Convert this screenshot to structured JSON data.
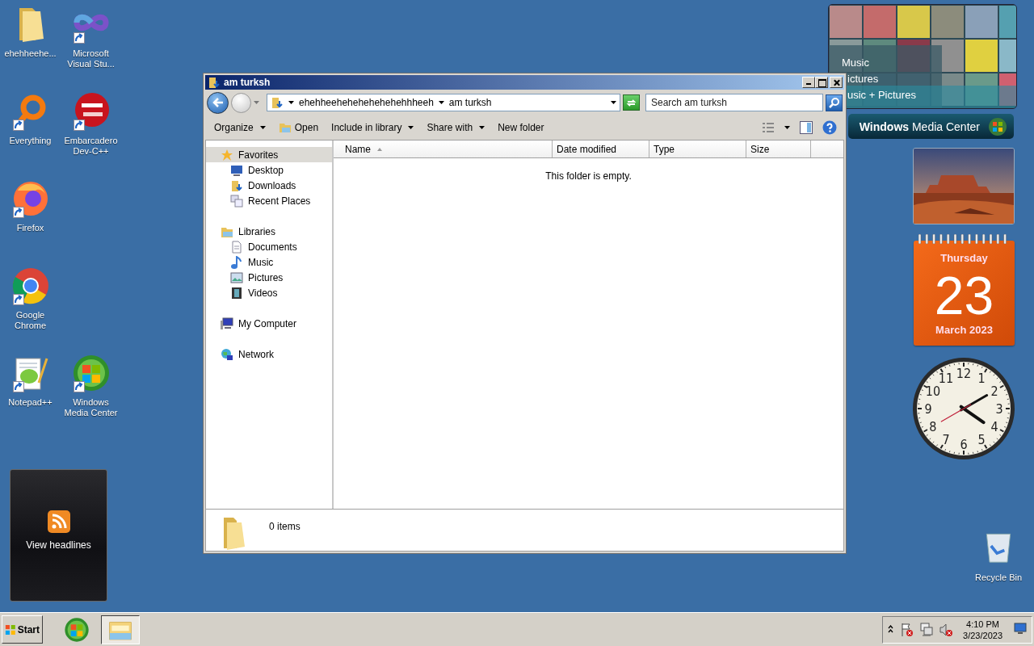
{
  "desktop_icon_rows": [
    [
      {
        "label": [
          "ehehheehe..."
        ],
        "kind": "folder",
        "shortcut": false
      },
      {
        "label": [
          "Microsoft",
          "Visual Stu..."
        ],
        "kind": "visual-studio",
        "shortcut": true
      }
    ],
    [
      {
        "label": [
          "Everything"
        ],
        "kind": "everything",
        "shortcut": true
      },
      {
        "label": [
          "Embarcadero",
          "Dev-C++"
        ],
        "kind": "devcpp",
        "shortcut": true
      }
    ],
    [
      {
        "label": [
          "Firefox"
        ],
        "kind": "firefox",
        "shortcut": true
      }
    ],
    [
      {
        "label": [
          "Google",
          "Chrome"
        ],
        "kind": "chrome",
        "shortcut": true
      }
    ],
    [
      {
        "label": [
          "Notepad++"
        ],
        "kind": "notepadpp",
        "shortcut": true
      },
      {
        "label": [
          "Windows",
          "Media Center"
        ],
        "kind": "media-center",
        "shortcut": true
      }
    ]
  ],
  "feed_gadget": {
    "label": "View headlines"
  },
  "media_center_gadget": {
    "menu": [
      "Music",
      "ictures",
      "usic + Pictures"
    ],
    "banner": "**Windows** Media Center"
  },
  "calendar_gadget": {
    "weekday": "Thursday",
    "day": "23",
    "month_year": "March 2023"
  },
  "clock_gadget": {
    "right_numerals": [
      "12",
      "1",
      "2",
      "3",
      "4",
      "5",
      "6"
    ],
    "left_numerals": [
      "11",
      "10",
      "9",
      "8",
      "7"
    ]
  },
  "recycle_bin": {
    "label": "Recycle Bin"
  },
  "explorer": {
    "title": "am turksh",
    "breadcrumb": [
      "ehehheehehehehehehehhheeh",
      "am turksh"
    ],
    "search": {
      "placeholder": "Search am turksh"
    },
    "toolbar": [
      {
        "label": "Organize",
        "kind": "plain",
        "dropdown": true
      },
      {
        "label": "Open",
        "kind": "iconic",
        "dropdown": false
      },
      {
        "label": "Include in library",
        "kind": "plain",
        "dropdown": true
      },
      {
        "label": "Share with",
        "kind": "plain",
        "dropdown": true
      },
      {
        "label": "New folder",
        "kind": "plain",
        "dropdown": false
      }
    ],
    "navigation": [
      {
        "label": "Favorites",
        "kind": "star",
        "selected": true,
        "children": [
          {
            "label": "Desktop",
            "kind": "desktop",
            "selected": false
          },
          {
            "label": "Downloads",
            "kind": "downloads",
            "selected": false
          },
          {
            "label": "Recent Places",
            "kind": "recent",
            "selected": false
          }
        ]
      },
      {
        "label": "Libraries",
        "kind": "library",
        "selected": false,
        "children": [
          {
            "label": "Documents",
            "kind": "documents",
            "selected": false
          },
          {
            "label": "Music",
            "kind": "music",
            "selected": false
          },
          {
            "label": "Pictures",
            "kind": "pictures",
            "selected": false
          },
          {
            "label": "Videos",
            "kind": "videos",
            "selected": false
          }
        ]
      },
      {
        "label": "My Computer",
        "kind": "computer",
        "selected": false
      },
      {
        "label": "Network",
        "kind": "network",
        "selected": false
      }
    ],
    "columns": [
      {
        "label": "Name",
        "sorted": true
      },
      {
        "label": "Date modified",
        "sorted": false
      },
      {
        "label": "Type",
        "sorted": false
      },
      {
        "label": "Size",
        "sorted": false
      }
    ],
    "empty_message": "This folder is empty.",
    "details": {
      "count": "0 items"
    }
  },
  "taskbar": {
    "start": "Start",
    "buttons": [
      {
        "kind": "media-center",
        "active": false
      },
      {
        "kind": "explorer",
        "active": true
      }
    ],
    "clock": {
      "time": "4:10 PM",
      "date": "3/23/2023"
    }
  }
}
